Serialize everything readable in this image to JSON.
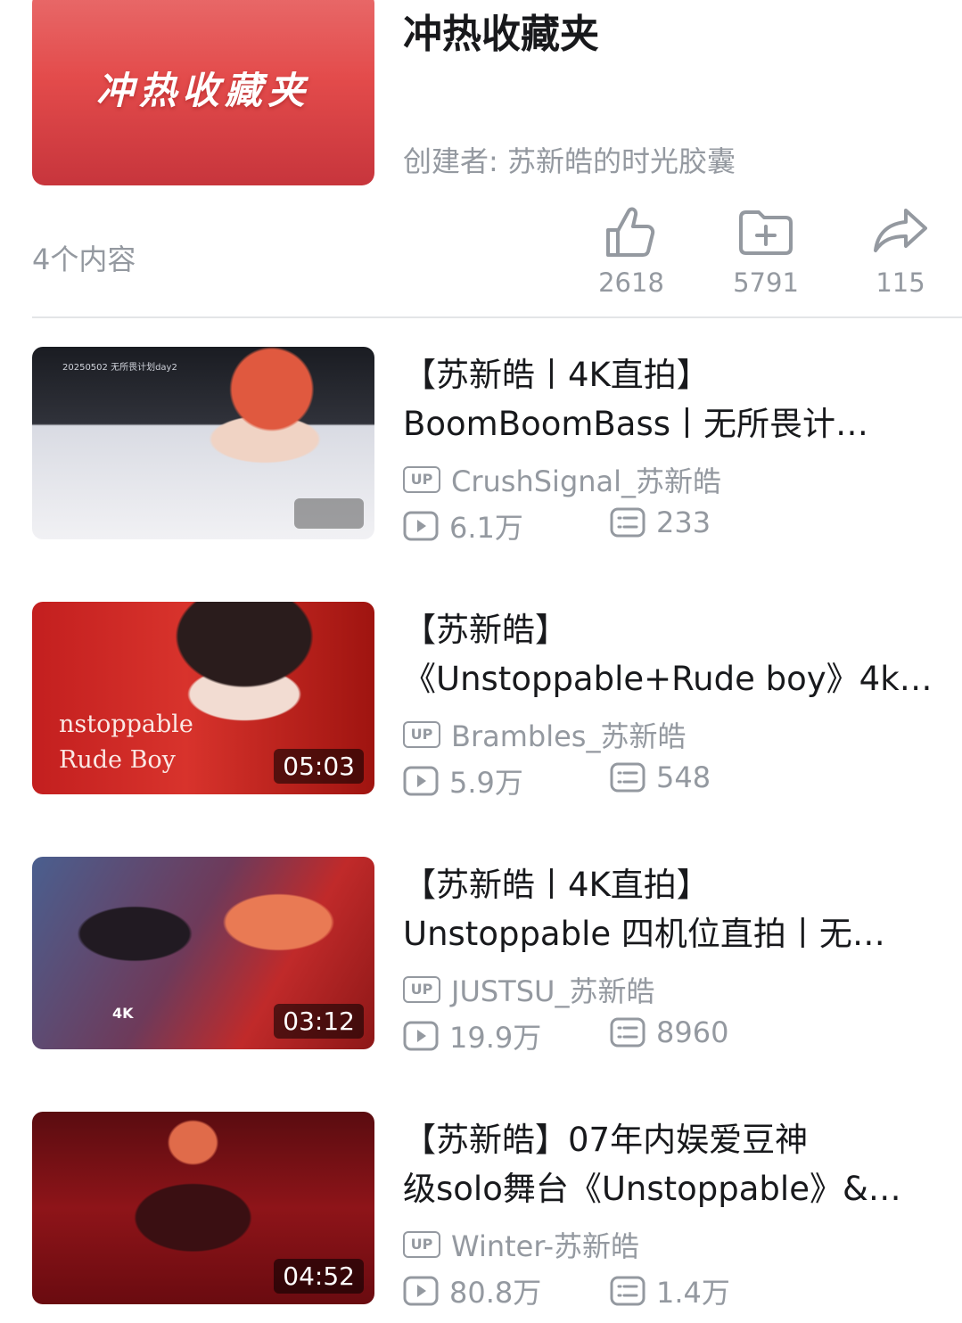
{
  "favorites": {
    "cover_text": "冲热收藏夹",
    "title": "冲热收藏夹",
    "creator": "创建者: 苏新皓的时光胶囊",
    "count": "4个内容",
    "actions": {
      "like": {
        "icon": "thumbs-up-icon",
        "count": "2618"
      },
      "collect": {
        "icon": "folder-add-icon",
        "count": "5791"
      },
      "share": {
        "icon": "share-arrow-icon",
        "count": "115"
      }
    }
  },
  "videos": [
    {
      "title_line1": "【苏新皓丨4K直拍】",
      "title_line2": "BoomBoomBass丨无所畏计…",
      "uploader": "CrushSignal_苏新皓",
      "views": "6.1万",
      "danmaku": "233",
      "duration": "",
      "thumb_caption": "20250502 无所畏计划day2"
    },
    {
      "title_line1": "【苏新皓】",
      "title_line2": "《Unstoppable+Rude boy》4k…",
      "uploader": "Brambles_苏新皓",
      "views": "5.9万",
      "danmaku": "548",
      "duration": "05:03",
      "thumb_caption": "nstoppable Rude Boy"
    },
    {
      "title_line1": "【苏新皓丨4K直拍】",
      "title_line2": "Unstoppable 四机位直拍丨无…",
      "uploader": "JUSTSU_苏新皓",
      "views": "19.9万",
      "danmaku": "8960",
      "duration": "03:12",
      "thumb_caption": "4K"
    },
    {
      "title_line1": "【苏新皓】07年内娱爱豆神",
      "title_line2": "级solo舞台《Unstoppable》&…",
      "uploader": "Winter-苏新皓",
      "views": "80.8万",
      "danmaku": "1.4万",
      "duration": "04:52",
      "thumb_caption": ""
    }
  ],
  "labels": {
    "up_badge": "UP"
  },
  "colors": {
    "meta_gray": "#9499a0",
    "accent_red": "#e34b4b",
    "text": "#18191c"
  }
}
